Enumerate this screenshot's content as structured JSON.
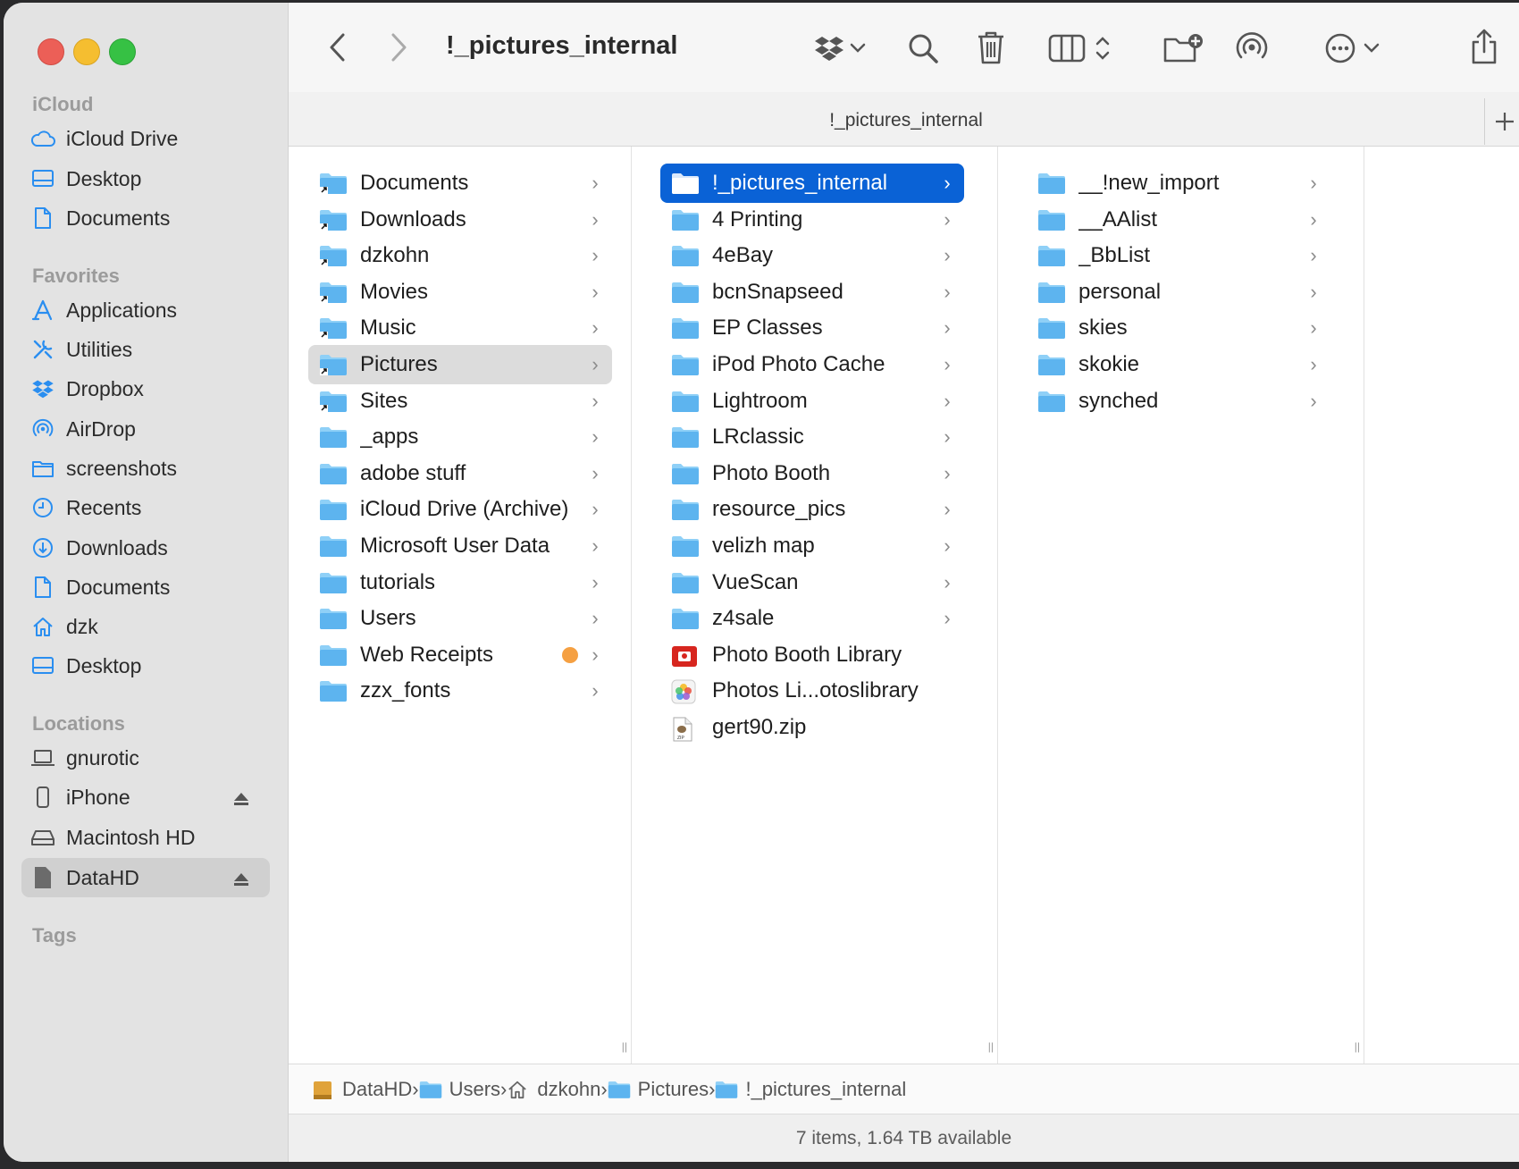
{
  "window": {
    "title": "!_pictures_internal",
    "tab_title": "!_pictures_internal",
    "status": "7 items, 1.64 TB available"
  },
  "sidebar": {
    "sections": [
      {
        "title": "iCloud",
        "items": [
          {
            "label": "iCloud Drive",
            "icon": "cloud-icon"
          },
          {
            "label": "Desktop",
            "icon": "desktop-icon"
          },
          {
            "label": "Documents",
            "icon": "document-icon"
          }
        ]
      },
      {
        "title": "Favorites",
        "items": [
          {
            "label": "Applications",
            "icon": "applications-icon"
          },
          {
            "label": "Utilities",
            "icon": "utilities-icon"
          },
          {
            "label": "Dropbox",
            "icon": "dropbox-icon"
          },
          {
            "label": "AirDrop",
            "icon": "airdrop-icon"
          },
          {
            "label": "screenshots",
            "icon": "folder-icon"
          },
          {
            "label": "Recents",
            "icon": "clock-icon"
          },
          {
            "label": "Downloads",
            "icon": "download-icon"
          },
          {
            "label": "Documents",
            "icon": "document-icon"
          },
          {
            "label": "dzk",
            "icon": "home-icon"
          },
          {
            "label": "Desktop",
            "icon": "desktop-icon"
          }
        ]
      },
      {
        "title": "Locations",
        "items": [
          {
            "label": "gnurotic",
            "icon": "laptop-icon"
          },
          {
            "label": "iPhone",
            "icon": "iphone-icon"
          },
          {
            "label": "Macintosh HD",
            "icon": "harddrive-icon"
          },
          {
            "label": "DataHD",
            "icon": "drive-icon"
          }
        ]
      },
      {
        "title": "Tags",
        "items": []
      }
    ]
  },
  "columns": {
    "col1": [
      {
        "label": "Documents",
        "alias": true
      },
      {
        "label": "Downloads",
        "alias": true
      },
      {
        "label": "dzkohn",
        "alias": true
      },
      {
        "label": "Movies",
        "alias": true
      },
      {
        "label": "Music",
        "alias": true
      },
      {
        "label": "Pictures",
        "alias": true,
        "selected": true
      },
      {
        "label": "Sites",
        "alias": true
      },
      {
        "label": "_apps"
      },
      {
        "label": "adobe stuff"
      },
      {
        "label": "iCloud Drive (Archive)"
      },
      {
        "label": "Microsoft User Data"
      },
      {
        "label": "tutorials"
      },
      {
        "label": "Users"
      },
      {
        "label": "Web Receipts",
        "tag": "orange"
      },
      {
        "label": "zzx_fonts"
      }
    ],
    "col2": [
      {
        "label": "!_pictures_internal",
        "selected": true
      },
      {
        "label": "4 Printing"
      },
      {
        "label": "4eBay"
      },
      {
        "label": "bcnSnapseed"
      },
      {
        "label": "EP Classes"
      },
      {
        "label": "iPod Photo Cache"
      },
      {
        "label": "Lightroom"
      },
      {
        "label": "LRclassic"
      },
      {
        "label": "Photo Booth"
      },
      {
        "label": "resource_pics"
      },
      {
        "label": "velizh map"
      },
      {
        "label": "VueScan"
      },
      {
        "label": "z4sale"
      },
      {
        "label": "Photo Booth Library",
        "kind": "photobooth"
      },
      {
        "label": "Photos Li...otoslibrary",
        "kind": "photos"
      },
      {
        "label": "gert90.zip",
        "kind": "zip"
      }
    ],
    "col3": [
      {
        "label": "__!new_import"
      },
      {
        "label": "__AAlist"
      },
      {
        "label": "_BbList"
      },
      {
        "label": "personal"
      },
      {
        "label": "skies"
      },
      {
        "label": "skokie"
      },
      {
        "label": "synched"
      }
    ]
  },
  "pathbar": [
    {
      "label": "DataHD",
      "icon": "drive-icon"
    },
    {
      "label": "Users",
      "icon": "folder-icon"
    },
    {
      "label": "dzkohn",
      "icon": "home-icon"
    },
    {
      "label": "Pictures",
      "icon": "folder-icon"
    },
    {
      "label": "!_pictures_internal",
      "icon": "folder-icon"
    }
  ],
  "colors": {
    "accent": "#0a62d6",
    "folder": "#5db4ef",
    "tag_orange": "#f5a042"
  }
}
